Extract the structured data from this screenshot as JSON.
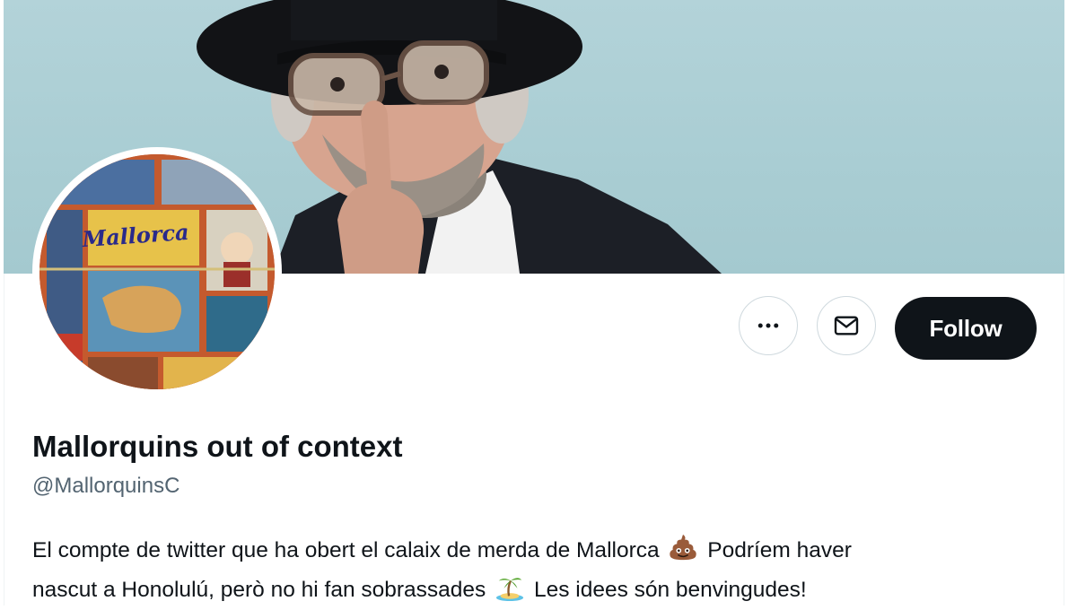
{
  "profile": {
    "display_name": "Mallorquins out of context",
    "handle": "@MallorquinsC",
    "bio": {
      "line1_part1": "El compte de twitter que ha obert el calaix de merda de Mallorca",
      "line1_part2": "Podríem haver",
      "line2_part1": "nascut a Honolulú, però no hi fan sobrassades",
      "line2_part2": "Les idees són benvingudes!",
      "emoji1": "pile-of-poo-emoji",
      "emoji2": "desert-island-emoji"
    },
    "avatar_text": "Mallorca"
  },
  "actions": {
    "more_icon": "more-horizontal-icon",
    "message_icon": "envelope-icon",
    "follow_label": "Follow"
  },
  "colors": {
    "follow_bg": "#0f1419",
    "banner_bg": "#aecfd5",
    "secondary_text": "#536471",
    "button_border": "#cfd9de"
  }
}
